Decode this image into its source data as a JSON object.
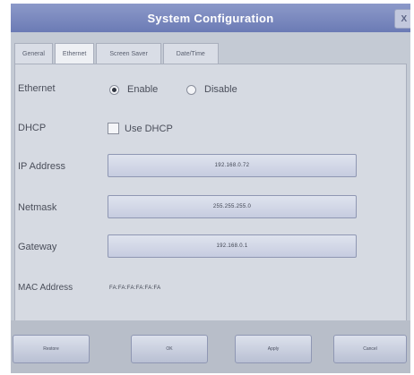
{
  "window": {
    "title": "System Configuration",
    "close_label": "X"
  },
  "tabs": [
    {
      "label": "General"
    },
    {
      "label": "Ethernet",
      "active": true
    },
    {
      "label": "Screen Saver"
    },
    {
      "label": "Date/Time"
    }
  ],
  "ethernet": {
    "label": "Ethernet",
    "enable_label": "Enable",
    "disable_label": "Disable",
    "selected": "Enable"
  },
  "dhcp": {
    "label": "DHCP",
    "checkbox_label": "Use DHCP",
    "checked": false
  },
  "ip_address": {
    "label": "IP Address",
    "value": "192.168.0.72"
  },
  "netmask": {
    "label": "Netmask",
    "value": "255.255.255.0"
  },
  "gateway": {
    "label": "Gateway",
    "value": "192.168.0.1"
  },
  "mac_address": {
    "label": "MAC Address",
    "value": "FA:FA:FA:FA:FA:FA"
  },
  "buttons": {
    "restore": "Restore",
    "ok": "OK",
    "apply": "Apply",
    "cancel": "Cancel"
  },
  "colors": {
    "title_bar": "#7483bd",
    "panel": "#d6dae2",
    "field": "#ccd2e4"
  }
}
